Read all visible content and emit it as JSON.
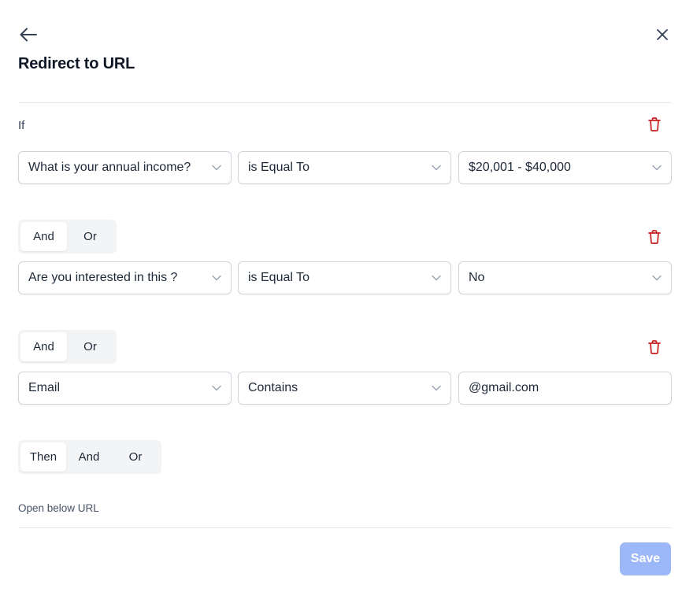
{
  "header": {
    "title": "Redirect to URL",
    "back_icon": "arrow-left-icon",
    "close_icon": "close-icon"
  },
  "rules": [
    {
      "connector": null,
      "field": "What is your annual income?",
      "operator": "is Equal To",
      "value": "$20,001 - $40,000",
      "value_type": "select"
    },
    {
      "connector": {
        "options": [
          "And",
          "Or"
        ],
        "selected": "And"
      },
      "field": "Are you interested in this ?",
      "operator": "is Equal To",
      "value": "No",
      "value_type": "select"
    },
    {
      "connector": {
        "options": [
          "And",
          "Or"
        ],
        "selected": "And"
      },
      "field": "Email",
      "operator": "Contains",
      "value": "@gmail.com",
      "value_type": "input"
    }
  ],
  "if_label": "If",
  "then_group": {
    "options": [
      "Then",
      "And",
      "Or"
    ],
    "selected": "Then"
  },
  "open_label": "Open below URL",
  "save_label": "Save",
  "colors": {
    "delete": "#c81e1e",
    "accent_disabled": "#9db8f8",
    "text": "#1d2939",
    "border": "#d0d5dd"
  }
}
